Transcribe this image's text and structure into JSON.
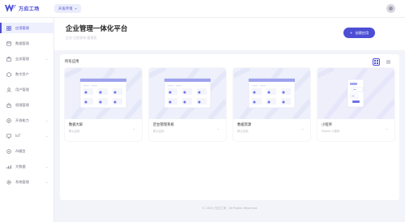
{
  "app": {
    "logo_text": "万应工场",
    "env_tag": "开发环境"
  },
  "sidebar": {
    "items": [
      {
        "label": "应用管理",
        "icon": "app-icon",
        "active": true
      },
      {
        "label": "数据管理",
        "icon": "database-icon"
      },
      {
        "label": "业务管理",
        "icon": "briefcase-icon",
        "chevron": true
      },
      {
        "label": "数字资产",
        "icon": "asset-icon"
      },
      {
        "label": "用户管理",
        "icon": "user-icon"
      },
      {
        "label": "权限管理",
        "icon": "lock-icon"
      },
      {
        "label": "开放能力",
        "icon": "open-icon",
        "chevron": true
      },
      {
        "label": "IoT",
        "icon": "iot-icon",
        "chevron": true
      },
      {
        "label": "AI模型",
        "icon": "ai-icon"
      },
      {
        "label": "大数据",
        "icon": "bigdata-icon",
        "chevron": true
      },
      {
        "label": "系统管理",
        "icon": "settings-icon",
        "chevron": true
      }
    ]
  },
  "header": {
    "title": "企业管理一体化平台",
    "subtitle": "企业·已经发布·管理员",
    "create_button": "创建应用"
  },
  "section": {
    "title": "所有应用",
    "cards": [
      {
        "name": "数据大屏",
        "desc": "默认应用",
        "thumb": "dashboard"
      },
      {
        "name": "后台管理系统",
        "desc": "默认应用",
        "thumb": "dashboard"
      },
      {
        "name": "数据资源",
        "desc": "默认应用",
        "thumb": "dashboard"
      },
      {
        "name": "小程序",
        "desc": "Mobile 小程序",
        "thumb": "mobile"
      }
    ]
  },
  "footer": {
    "text": "© 2023 万应工场 · All Rights Reserved"
  },
  "colors": {
    "accent": "#4c4ed4",
    "background": "#f3f4f9"
  }
}
